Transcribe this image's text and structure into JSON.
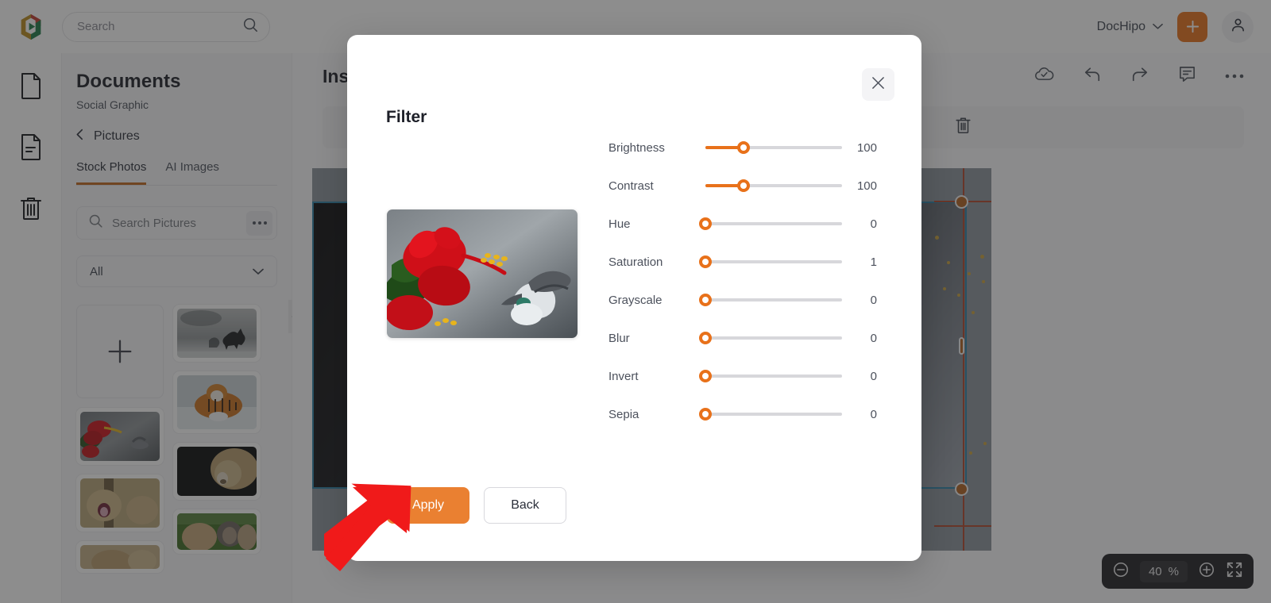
{
  "topbar": {
    "logo_name": "dochipo-logo",
    "search_placeholder": "Search",
    "search_value": "",
    "brand_label": "DocHipo",
    "add_label": "+",
    "icons": {
      "search": "search-icon",
      "chevron": "chevron-down-icon",
      "avatar": "user-avatar-icon"
    }
  },
  "rail": {
    "items": [
      {
        "name": "pages-icon",
        "label": "Pages"
      },
      {
        "name": "document-icon",
        "label": "Document"
      },
      {
        "name": "trash-icon",
        "label": "Trash"
      }
    ]
  },
  "panel": {
    "title": "Documents",
    "subtitle": "Social Graphic",
    "breadcrumb": "Pictures",
    "back_icon": "chevron-left-icon",
    "tabs": [
      {
        "label": "Stock Photos",
        "active": true
      },
      {
        "label": "AI Images",
        "active": false
      }
    ],
    "search_placeholder": "Search Pictures",
    "search_value": "",
    "more_icon": "ellipsis-icon",
    "filter_value": "All",
    "upload_label": "+",
    "thumbnails": [
      {
        "alt": "hummingbird-and-red-hibiscus"
      },
      {
        "alt": "lioness-roaring"
      },
      {
        "alt": "lion-closeup-bottom"
      },
      {
        "alt": "horses-in-fog"
      },
      {
        "alt": "tiger-in-snow"
      },
      {
        "alt": "lion-portrait"
      },
      {
        "alt": "monkeys-grooming"
      }
    ]
  },
  "editor": {
    "title": "Ins",
    "toolbar": [
      {
        "name": "cloud-saved-icon",
        "label": "Saved"
      },
      {
        "name": "undo-icon",
        "label": "Undo"
      },
      {
        "name": "redo-icon",
        "label": "Redo"
      },
      {
        "name": "comment-icon",
        "label": "Comments"
      },
      {
        "name": "more-options-icon",
        "label": "More"
      }
    ],
    "context_delete_icon": "trash-icon",
    "zoom": {
      "minus": "zoom-out-icon",
      "value": "40",
      "unit": "%",
      "plus": "zoom-in-icon",
      "fullscreen": "fullscreen-icon"
    }
  },
  "modal": {
    "title": "Filter",
    "close_icon": "close-icon",
    "preview_alt": "hummingbird-and-red-hibiscus-preview",
    "sliders": [
      {
        "label": "Brightness",
        "value": "100",
        "pct": 28
      },
      {
        "label": "Contrast",
        "value": "100",
        "pct": 28
      },
      {
        "label": "Hue",
        "value": "0",
        "pct": 0
      },
      {
        "label": "Saturation",
        "value": "1",
        "pct": 0
      },
      {
        "label": "Grayscale",
        "value": "0",
        "pct": 0
      },
      {
        "label": "Blur",
        "value": "0",
        "pct": 0
      },
      {
        "label": "Invert",
        "value": "0",
        "pct": 0
      },
      {
        "label": "Sepia",
        "value": "0",
        "pct": 0
      }
    ],
    "apply_label": "Apply",
    "back_label": "Back"
  },
  "annotation": {
    "arrow_name": "pointer-arrow",
    "color": "#f01a1a",
    "target": "Apply"
  },
  "colors": {
    "accent": "#e8711a",
    "apply": "#ea8031",
    "rail_active": "#c1661d",
    "selection": "#2a7fa6",
    "guide": "#b0442a",
    "overlay": "rgba(40,40,40,0.53)"
  }
}
